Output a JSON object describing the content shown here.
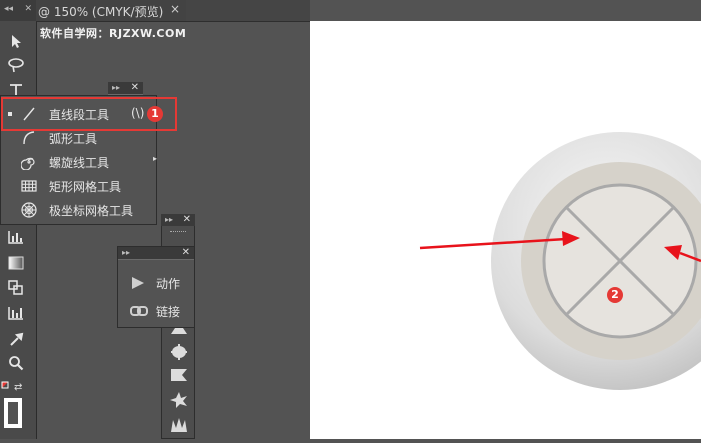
{
  "document_tab": {
    "title": "@ 150% (CMYK/预览)",
    "close": "×"
  },
  "watermark": "软件自学网：RJZXW.COM",
  "flyout_menu": {
    "items": [
      {
        "label": "直线段工具",
        "shortcut": "(\\)",
        "icon": "line-segment-icon",
        "selected": true
      },
      {
        "label": "弧形工具",
        "icon": "arc-icon"
      },
      {
        "label": "螺旋线工具",
        "icon": "spiral-icon"
      },
      {
        "label": "矩形网格工具",
        "icon": "rectangular-grid-icon"
      },
      {
        "label": "极坐标网格工具",
        "icon": "polar-grid-icon"
      }
    ]
  },
  "action_panel": {
    "items": [
      {
        "label": "动作",
        "icon": "play-icon"
      },
      {
        "label": "链接",
        "icon": "link-icon"
      }
    ]
  },
  "annotations": {
    "badge1": "1",
    "badge2": "2"
  },
  "colors": {
    "highlight": "#e53935",
    "arrow": "#e8131b",
    "panel": "#535353",
    "canvas": "#ffffff"
  }
}
